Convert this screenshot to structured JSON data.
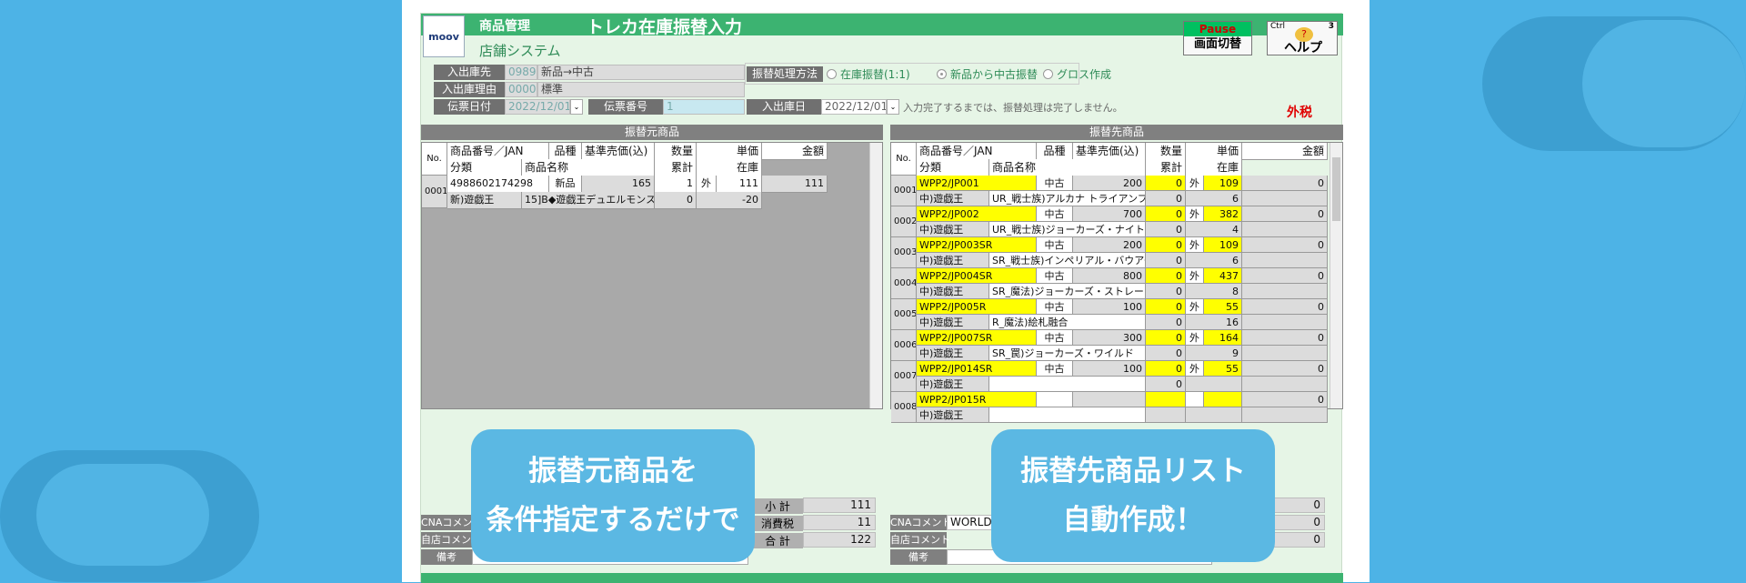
{
  "app": {
    "logo": "moov",
    "module": "商品管理",
    "title": "トレカ在庫振替入力",
    "system": "店舗システム",
    "pause": {
      "top": "Pause",
      "bottom": "画面切替"
    },
    "help": {
      "top": "Ctrl",
      "num": "3",
      "label": "ヘルプ"
    }
  },
  "header": {
    "warehouse_label": "入出庫先",
    "warehouse_code": "0989",
    "warehouse_name": "新品→中古",
    "reason_label": "入出庫理由",
    "reason_code": "00000",
    "reason_name": "標準",
    "slip_date_label": "伝票日付",
    "slip_date": "2022/12/01",
    "slip_no_label": "伝票番号",
    "slip_no": "1",
    "io_date_label": "入出庫日",
    "io_date": "2022/12/01",
    "method_label": "振替処理方法",
    "options": [
      "在庫振替(1:1)",
      "新品から中古振替",
      "グロス作成"
    ],
    "selected_option": "新品から中古振替",
    "note": "入力完了するまでは、振替処理は完了しません。",
    "tax": "外税"
  },
  "source": {
    "title": "振替元商品",
    "h": {
      "no": "No.",
      "code": "商品番号／JAN",
      "kind": "品種",
      "price": "基準売価(込)",
      "qty": "数量",
      "unit": "単価",
      "amount": "金額",
      "cat": "分類",
      "name": "商品名称",
      "cum": "累計",
      "stock": "在庫"
    },
    "row": {
      "no": "0001",
      "code": "4988602174298",
      "kind": "新品",
      "price": "165",
      "qty": "1",
      "tax": "外",
      "unit": "111",
      "amount": "111",
      "cat": "新)遊戯王",
      "name": "15]B◆遊戯王デュエルモンスターズ゛WC",
      "cum": "0",
      "stock": "-20"
    },
    "subtotal_label": "小 計",
    "subtotal": "111",
    "tax_label": "消費税",
    "tax_val": "11",
    "total_label": "合 計",
    "total": "122",
    "cna_label": "CNAコメント",
    "store_label": "自店コメント",
    "memo_label": "備考"
  },
  "dest": {
    "title": "振替先商品",
    "h": {
      "no": "No.",
      "code": "商品番号／JAN",
      "kind": "品種",
      "price": "基準売価(込)",
      "qty": "数量",
      "unit": "単価",
      "amount": "金額",
      "cat": "分類",
      "name": "商品名称",
      "cum": "累計",
      "stock": "在庫"
    },
    "rows": [
      {
        "no": "0001",
        "code": "WPP2/JP001",
        "kind": "中古",
        "price": "200",
        "qty": "0",
        "tax": "外",
        "unit": "109",
        "amount": "0",
        "cat": "中)遊戯王",
        "name": "UR_戦士族)アルカナ トライアンフジ",
        "cum": "0",
        "stock": "6"
      },
      {
        "no": "0002",
        "code": "WPP2/JP002",
        "kind": "中古",
        "price": "700",
        "qty": "0",
        "tax": "外",
        "unit": "382",
        "amount": "0",
        "cat": "中)遊戯王",
        "name": "UR_戦士族)ジョーカーズ・ナイト",
        "cum": "0",
        "stock": "4"
      },
      {
        "no": "0003",
        "code": "WPP2/JP003SR",
        "kind": "中古",
        "price": "200",
        "qty": "0",
        "tax": "外",
        "unit": "109",
        "amount": "0",
        "cat": "中)遊戯王",
        "name": "SR_戦士族)インペリアル・バウアー",
        "cum": "0",
        "stock": "6"
      },
      {
        "no": "0004",
        "code": "WPP2/JP004SR",
        "kind": "中古",
        "price": "800",
        "qty": "0",
        "tax": "外",
        "unit": "437",
        "amount": "0",
        "cat": "中)遊戯王",
        "name": "SR_魔法)ジョーカーズ・ストレート",
        "cum": "0",
        "stock": "8"
      },
      {
        "no": "0005",
        "code": "WPP2/JP005R",
        "kind": "中古",
        "price": "100",
        "qty": "0",
        "tax": "外",
        "unit": "55",
        "amount": "0",
        "cat": "中)遊戯王",
        "name": "R_魔法)絵札融合",
        "cum": "0",
        "stock": "16"
      },
      {
        "no": "0006",
        "code": "WPP2/JP007SR",
        "kind": "中古",
        "price": "300",
        "qty": "0",
        "tax": "外",
        "unit": "164",
        "amount": "0",
        "cat": "中)遊戯王",
        "name": "SR_罠)ジョーカーズ・ワイルド",
        "cum": "0",
        "stock": "9"
      },
      {
        "no": "0007",
        "code": "WPP2/JP014SR",
        "kind": "中古",
        "price": "100",
        "qty": "0",
        "tax": "外",
        "unit": "55",
        "amount": "0",
        "cat": "中)遊戯王",
        "name": "",
        "cum": "0",
        "stock": ""
      },
      {
        "no": "0008",
        "code": "WPP2/JP015R",
        "kind": "",
        "price": "",
        "qty": "",
        "tax": "",
        "unit": "",
        "amount": "0",
        "cat": "中)遊戯王",
        "name": "",
        "cum": "",
        "stock": ""
      }
    ],
    "totals": [
      "0",
      "0",
      "0"
    ],
    "cna_label": "CNAコメント",
    "cna_value": "WORLD",
    "store_label": "自店コメント",
    "memo_label": "備考"
  },
  "bubbles": {
    "left": [
      "振替元商品を",
      "条件指定するだけで"
    ],
    "right": [
      "振替先商品リスト",
      "自動作成！"
    ]
  }
}
